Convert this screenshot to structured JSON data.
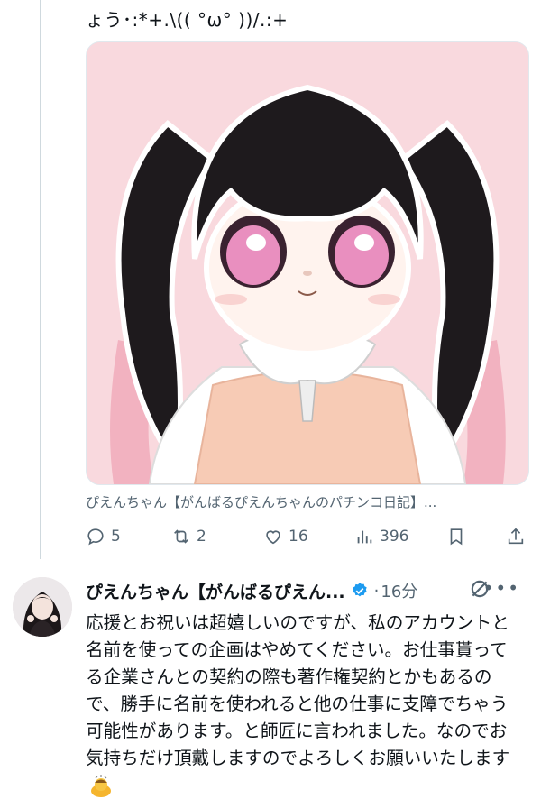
{
  "previous_tweet": {
    "text_fragment": "ょう･:*+.\\(( °ω° ))/.:+",
    "card_source": "ぴえんちゃん【がんばるぴえんちゃんのパチンコ日記】...",
    "actions": {
      "replies": "5",
      "retweets": "2",
      "likes": "16",
      "views": "396"
    }
  },
  "reply_tweet": {
    "author_name": "ぴえんちゃん【がんばるぴえん...",
    "separator": "·",
    "time": "16分",
    "body": "応援とお祝いは超嬉しいのですが、私のアカウントと名前を使っての企画はやめてください。お仕事貰ってる企業さんとの契約の際も著作権契約とかもあるので、勝手に名前を使われると他の仕事に支障でちゃう可能性があります。と師匠に言われました。なのでお気持ちだけ頂戴しますのでよろしくお願いいたします"
  },
  "colors": {
    "verified_blue": "#1d9bf0",
    "muted_text": "#536471",
    "thread_line": "#cfd9de",
    "image_bg": "#f9d9de"
  },
  "icons": [
    "reply-icon",
    "retweet-icon",
    "like-icon",
    "views-icon",
    "bookmark-icon",
    "share-icon",
    "verified-icon",
    "grok-icon",
    "more-icon",
    "bowing-emoji"
  ]
}
